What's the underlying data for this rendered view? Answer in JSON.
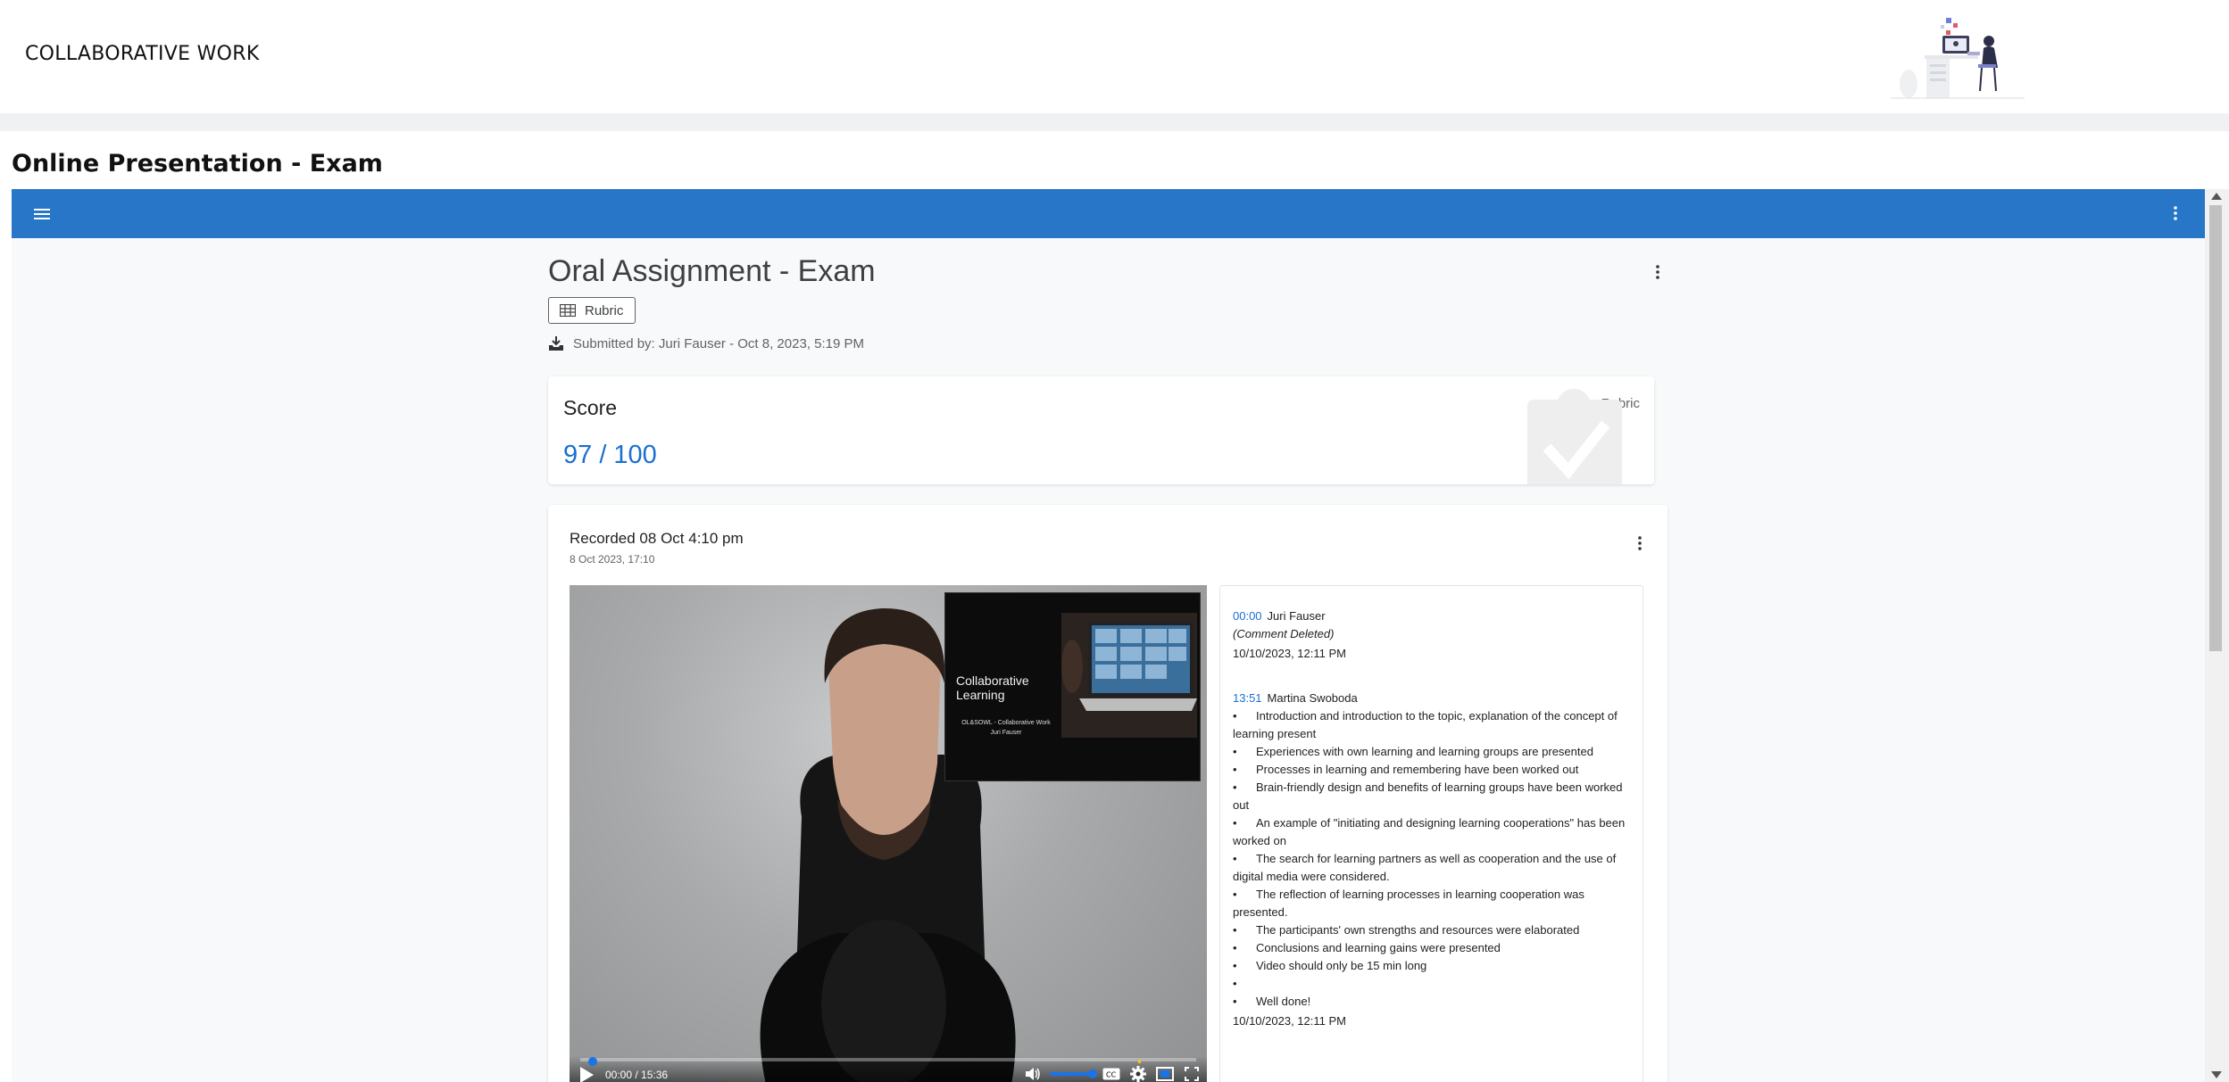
{
  "site": {
    "title": "COLLABORATIVE WORK"
  },
  "page": {
    "title": "Online Presentation - Exam"
  },
  "assignment": {
    "title": "Oral Assignment - Exam",
    "rubric_label": "Rubric",
    "submitted_text": "Submitted by: Juri Fauser - Oct 8, 2023, 5:19 PM"
  },
  "score": {
    "label": "Score",
    "value": "97 / 100",
    "rubric_label": "Rubric"
  },
  "recording": {
    "title": "Recorded 08 Oct 4:10 pm",
    "date": "8 Oct 2023, 17:10",
    "slide": {
      "title_line1": "Collaborative",
      "title_line2": "Learning",
      "subtitle_line1": "OL&SOWL - Collaborative Work",
      "subtitle_line2": "Juri Fauser"
    },
    "player": {
      "time": "00:00 / 15:36",
      "progress": 0.0,
      "volume": 1.0,
      "icons": [
        "play-icon",
        "volume-icon",
        "captions-icon",
        "settings-icon",
        "miniplayer-icon",
        "fullscreen-icon"
      ]
    }
  },
  "comments": [
    {
      "timestamp": "00:00",
      "author": "Juri Fauser",
      "body": "(Comment Deleted)",
      "date": "10/10/2023, 12:11 PM"
    },
    {
      "timestamp": "13:51",
      "author": "Martina Swoboda",
      "bullets": [
        "Introduction and introduction to the topic, explanation of the concept of learning present",
        "Experiences with own learning and learning groups are presented",
        "Processes in learning and remembering have been worked out",
        "Brain-friendly design and benefits of learning groups have been worked out",
        "An example of \"initiating and designing learning cooperations\" has been worked on",
        "The search for learning partners as well as cooperation and the use of digital media were considered.",
        "The reflection of learning processes in learning cooperation was presented.",
        "The participants' own strengths and resources were elaborated",
        "Conclusions and learning gains were presented",
        "Video should only be 15 min long",
        "",
        "Well done!"
      ],
      "bullet_char": "•",
      "date": "10/10/2023, 12:11 PM"
    }
  ],
  "colors": {
    "app_bar": "#2776c8",
    "accent_link": "#1a6fd0",
    "background": "#f8f9fa"
  }
}
